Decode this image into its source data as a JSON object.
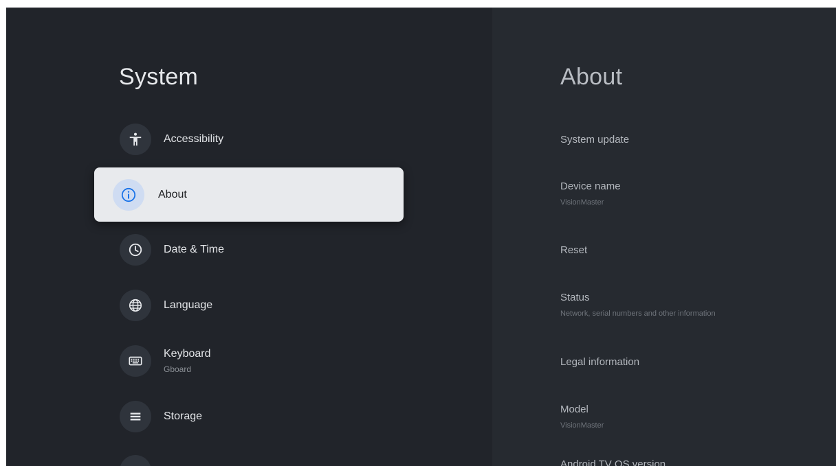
{
  "left": {
    "title": "System",
    "items": [
      {
        "label": "Accessibility",
        "sublabel": "",
        "icon": "accessibility-icon"
      },
      {
        "label": "About",
        "sublabel": "",
        "icon": "info-icon",
        "selected": true
      },
      {
        "label": "Date & Time",
        "sublabel": "",
        "icon": "clock-icon"
      },
      {
        "label": "Language",
        "sublabel": "",
        "icon": "globe-icon"
      },
      {
        "label": "Keyboard",
        "sublabel": "Gboard",
        "icon": "keyboard-icon"
      },
      {
        "label": "Storage",
        "sublabel": "",
        "icon": "storage-icon"
      }
    ]
  },
  "right": {
    "title": "About",
    "items": [
      {
        "label": "System update",
        "sublabel": ""
      },
      {
        "label": "Device name",
        "sublabel": "VisionMaster"
      },
      {
        "label": "Reset",
        "sublabel": ""
      },
      {
        "label": "Status",
        "sublabel": "Network, serial numbers and other information"
      },
      {
        "label": "Legal information",
        "sublabel": ""
      },
      {
        "label": "Model",
        "sublabel": "VisionMaster"
      },
      {
        "label": "Android TV OS version",
        "sublabel": ""
      }
    ]
  },
  "colors": {
    "background_left": "#21242a",
    "background_right": "#262a30",
    "selected_card": "#e8eaed",
    "info_icon_accent": "#1a73e8"
  }
}
